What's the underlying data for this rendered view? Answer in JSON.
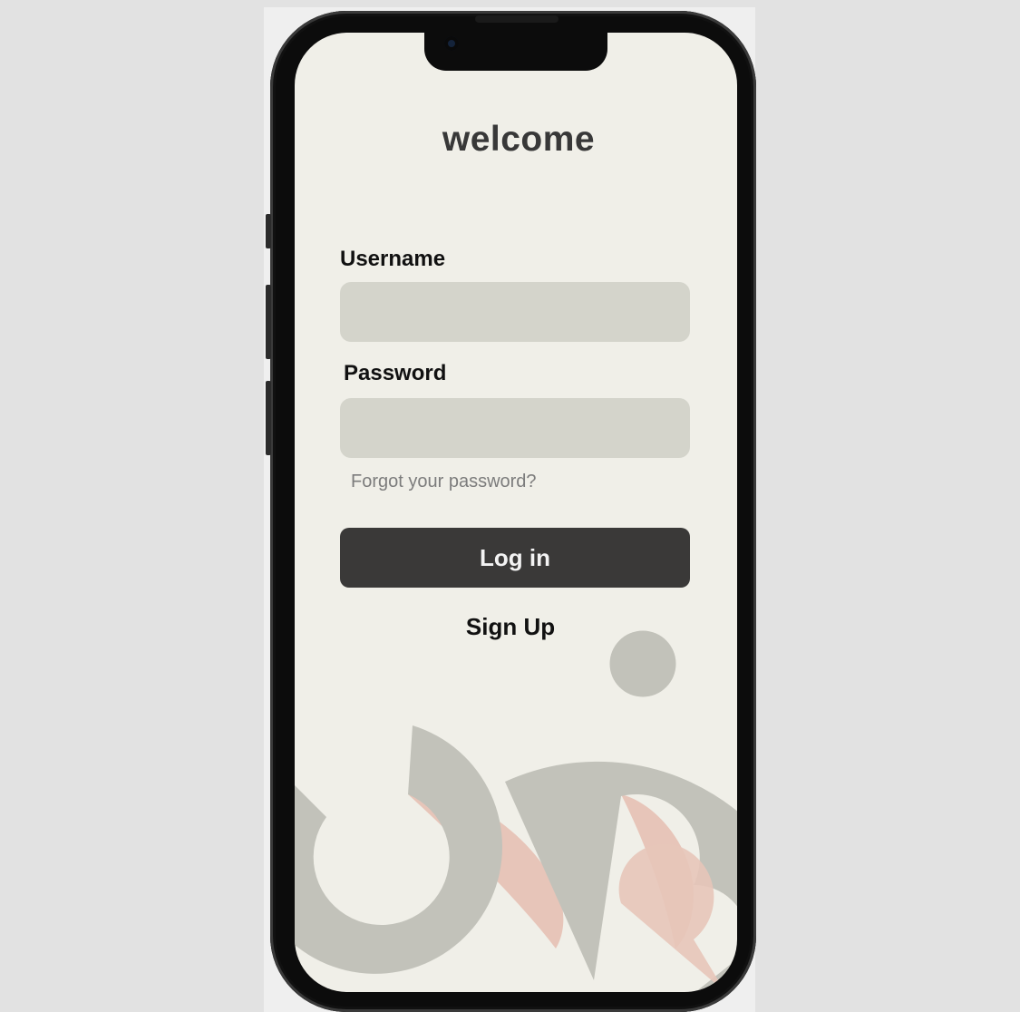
{
  "screen": {
    "title": "welcome"
  },
  "form": {
    "username_label": "Username",
    "username_value": "",
    "username_placeholder": "",
    "password_label": "Password",
    "password_value": "",
    "password_placeholder": "",
    "forgot_link": "Forgot your password?",
    "login_button": "Log in",
    "signup_link": "Sign Up"
  },
  "colors": {
    "background": "#f0efe8",
    "input_fill": "#d4d4cb",
    "button_fill": "#3a3938",
    "decor_gray": "#c2c2ba",
    "decor_pink": "#e7c5b9"
  }
}
